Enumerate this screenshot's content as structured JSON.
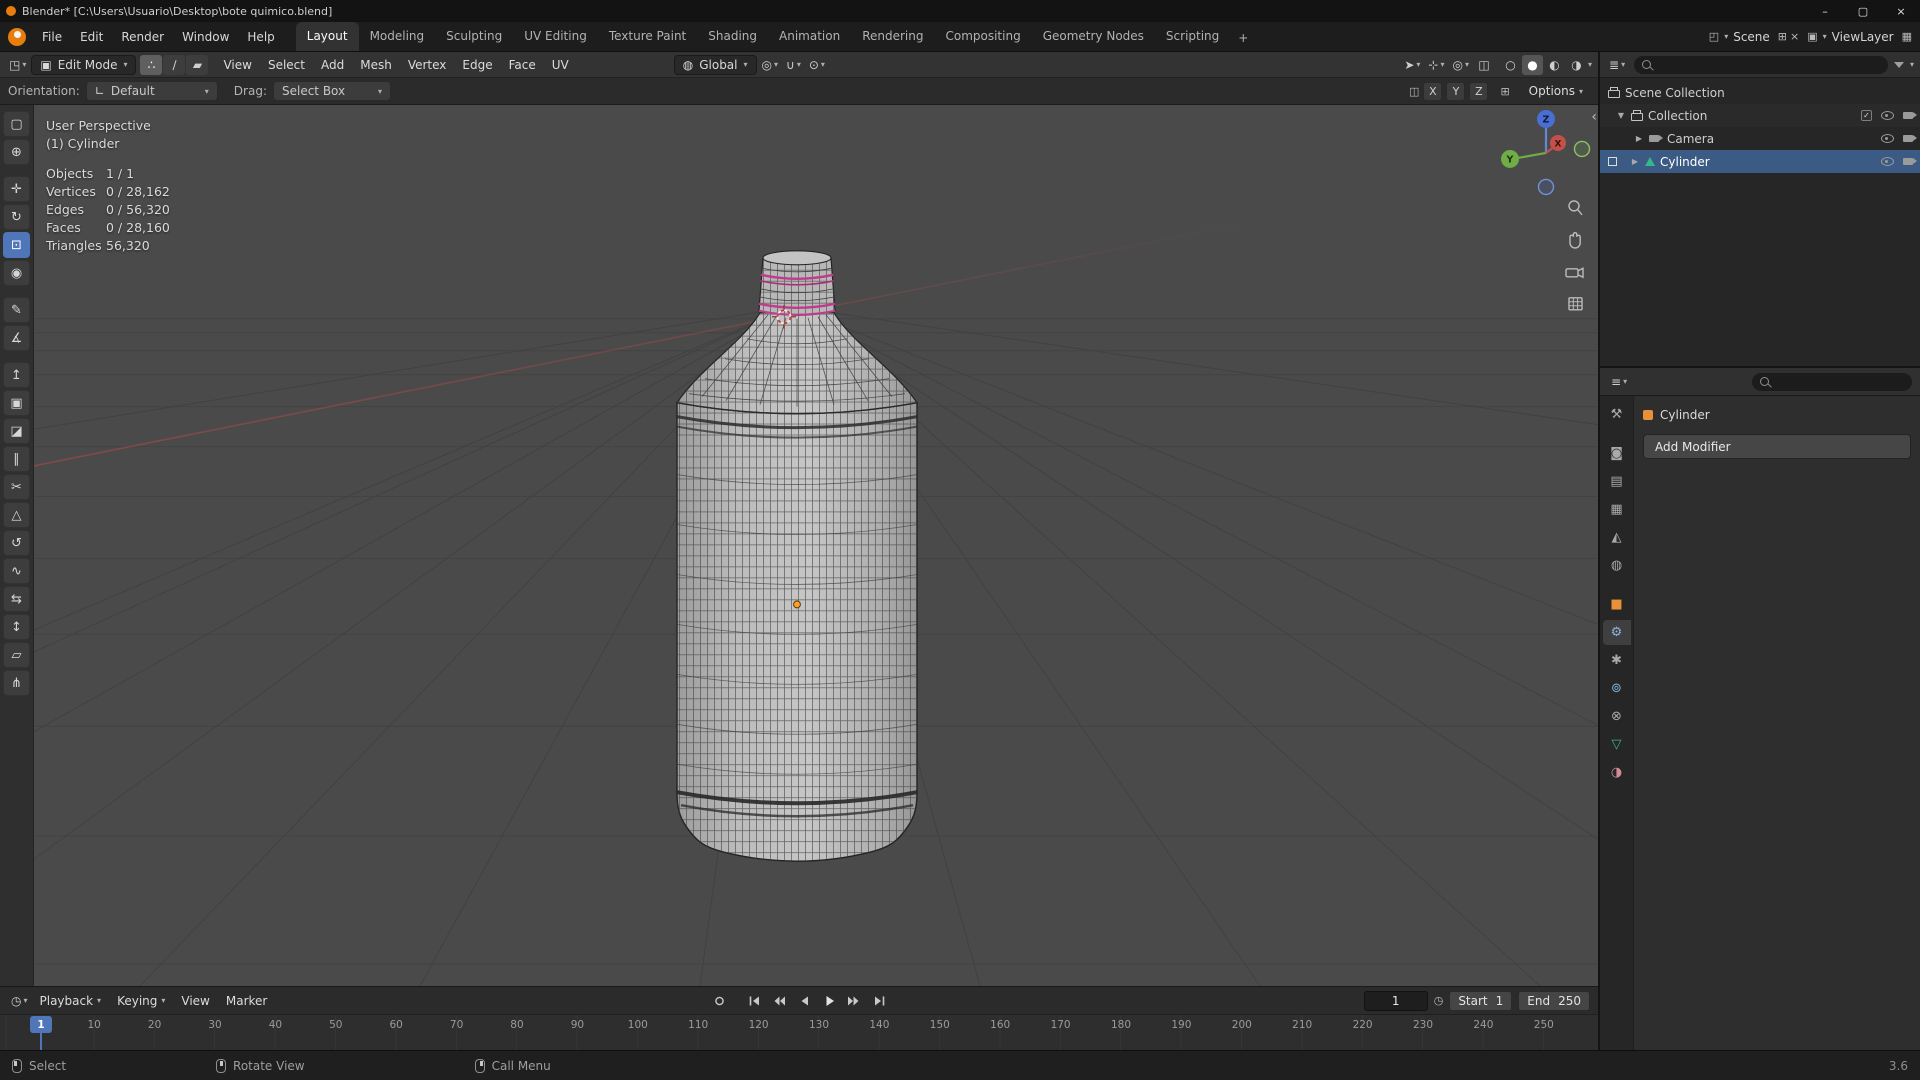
{
  "window": {
    "title": "Blender* [C:\\Users\\Usuario\\Desktop\\bote quimico.blend]",
    "minimize": "–",
    "maximize": "▢",
    "close": "×"
  },
  "topbar": {
    "menus": [
      "File",
      "Edit",
      "Render",
      "Window",
      "Help"
    ],
    "workspaces": [
      "Layout",
      "Modeling",
      "Sculpting",
      "UV Editing",
      "Texture Paint",
      "Shading",
      "Animation",
      "Rendering",
      "Compositing",
      "Geometry Nodes",
      "Scripting"
    ],
    "active_workspace": "Layout",
    "add_tab": "+",
    "scene_label": "Scene",
    "viewlayer_label": "ViewLayer"
  },
  "header": {
    "editor_icon": "◳",
    "mode": "Edit Mode",
    "mode_icon": "▣",
    "select_modes": [
      {
        "name": "vertex-select",
        "glyph": "∴"
      },
      {
        "name": "edge-select",
        "glyph": "∕"
      },
      {
        "name": "face-select",
        "glyph": "▰"
      }
    ],
    "menus": [
      "View",
      "Select",
      "Add",
      "Mesh",
      "Vertex",
      "Edge",
      "Face",
      "UV"
    ],
    "orientation_icon": "◍",
    "orientation": "Global",
    "pivot_icon": "◎",
    "snap_icon": "∪",
    "proportional_icon": "⊙",
    "right_icons": [
      {
        "name": "object-visibility",
        "glyph": "➤"
      },
      {
        "name": "show-gizmos",
        "glyph": "⊹"
      },
      {
        "name": "show-overlays",
        "glyph": "◎"
      },
      {
        "name": "toggle-xray",
        "glyph": "◫"
      }
    ],
    "shading_modes": [
      {
        "name": "wireframe-shading",
        "glyph": "○"
      },
      {
        "name": "solid-shading",
        "glyph": "●"
      },
      {
        "name": "material-preview-shading",
        "glyph": "◐"
      },
      {
        "name": "rendered-shading",
        "glyph": "◑"
      }
    ]
  },
  "tool_settings": {
    "orientation_label": "Orientation:",
    "orientation_icon": "∟",
    "orientation_value": "Default",
    "drag_label": "Drag:",
    "drag_value": "Select Box",
    "mirror_icon": "◫",
    "axes": [
      "X",
      "Y",
      "Z"
    ],
    "snap_base_icon": "⊞",
    "options": "Options"
  },
  "toolbar": {
    "active_tool": "scale",
    "tools": [
      {
        "name": "select-box",
        "glyph": "▢"
      },
      {
        "name": "cursor",
        "glyph": "⊕"
      },
      {
        "name": "move",
        "glyph": "✛"
      },
      {
        "name": "rotate",
        "glyph": "↻"
      },
      {
        "name": "scale",
        "glyph": "⊡"
      },
      {
        "name": "transform",
        "glyph": "◉"
      },
      {
        "name": "annotate",
        "glyph": "✎"
      },
      {
        "name": "measure",
        "glyph": "∡"
      },
      {
        "name": "extrude-region",
        "glyph": "↥"
      },
      {
        "name": "inset-faces",
        "glyph": "▣"
      },
      {
        "name": "bevel",
        "glyph": "◪"
      },
      {
        "name": "loop-cut",
        "glyph": "∥"
      },
      {
        "name": "knife",
        "glyph": "✂"
      },
      {
        "name": "poly-build",
        "glyph": "△"
      },
      {
        "name": "spin",
        "glyph": "↺"
      },
      {
        "name": "smooth",
        "glyph": "∿"
      },
      {
        "name": "edge-slide",
        "glyph": "⇆"
      },
      {
        "name": "shrink-fatten",
        "glyph": "↕"
      },
      {
        "name": "shear",
        "glyph": "▱"
      },
      {
        "name": "rip-region",
        "glyph": "⋔"
      }
    ]
  },
  "viewport": {
    "view_label": "User Perspective",
    "object_label": "(1) Cylinder",
    "stats": [
      {
        "label": "Objects",
        "value": "1 / 1"
      },
      {
        "label": "Vertices",
        "value": "0 / 28,162"
      },
      {
        "label": "Edges",
        "value": "0 / 56,320"
      },
      {
        "label": "Faces",
        "value": "0 / 28,160"
      },
      {
        "label": "Triangles",
        "value": "56,320"
      }
    ],
    "gizmo": {
      "z": "Z",
      "y": "Y",
      "x": "X"
    },
    "nav_icons": [
      "zoom-icon",
      "pan-hand-icon",
      "camera-view-icon",
      "orthographic-toggle-icon"
    ],
    "sidebar_arrow": "‹",
    "colors": {
      "seam_magenta": "#c23a8c",
      "origin_orange": "#ff9e2c"
    }
  },
  "outliner": {
    "rows": [
      {
        "label": "Scene Collection"
      },
      {
        "label": "Collection"
      },
      {
        "label": "Camera"
      },
      {
        "label": "Cylinder"
      }
    ],
    "selected": "Cylinder"
  },
  "properties": {
    "breadcrumb": "Cylinder",
    "add_modifier": "Add Modifier",
    "active_tab": "modifiers",
    "tabs": [
      {
        "name": "tool",
        "glyph": "⚒"
      },
      {
        "name": "render",
        "glyph": "◙"
      },
      {
        "name": "output",
        "glyph": "▤"
      },
      {
        "name": "view-layer",
        "glyph": "▦"
      },
      {
        "name": "scene",
        "glyph": "◭"
      },
      {
        "name": "world",
        "glyph": "◍"
      },
      {
        "name": "object",
        "glyph": "■"
      },
      {
        "name": "modifiers",
        "glyph": "⚙"
      },
      {
        "name": "particles",
        "glyph": "✱"
      },
      {
        "name": "physics",
        "glyph": "⊚"
      },
      {
        "name": "constraints",
        "glyph": "⊗"
      },
      {
        "name": "data",
        "glyph": "▽"
      },
      {
        "name": "material",
        "glyph": "◑"
      }
    ]
  },
  "timeline": {
    "editor_icon": "◷",
    "menus": [
      "Playback",
      "Keying",
      "View",
      "Marker"
    ],
    "transport": [
      "auto-keying",
      "jump-to-start",
      "previous-keyframe",
      "play-reverse",
      "play",
      "next-keyframe",
      "jump-to-end"
    ],
    "current_frame": "1",
    "playhead": "1",
    "clock_icon": "◷",
    "start_label": "Start",
    "start_value": "1",
    "end_label": "End",
    "end_value": "250",
    "ticks": [
      "10",
      "20",
      "30",
      "40",
      "50",
      "60",
      "70",
      "80",
      "90",
      "100",
      "110",
      "120",
      "130",
      "140",
      "150",
      "160",
      "170",
      "180",
      "190",
      "200",
      "210",
      "220",
      "230",
      "240",
      "250"
    ]
  },
  "statusbar": {
    "hints": [
      {
        "label": "Select"
      },
      {
        "label": "Rotate View"
      },
      {
        "label": "Call Menu"
      }
    ],
    "version": "3.6"
  },
  "colors": {
    "accent": "#4f76b8",
    "selection_blue": "#3b5b85",
    "object_orange": "#e8913a",
    "mesh_teal": "#37b58c",
    "seam_magenta": "#c23a8c"
  }
}
